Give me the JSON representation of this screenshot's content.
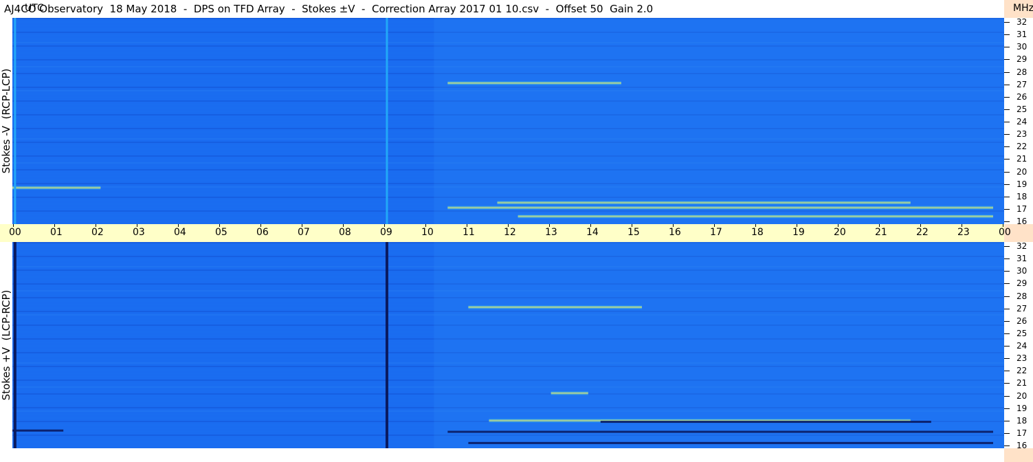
{
  "title": "AJ4CO Observatory  18 May 2018  -  DPS on TFD Array  -  Stokes ±V  -  Correction Array 2017 01 10.csv  -  Offset 50  Gain 2.0",
  "panels": {
    "top": {
      "label": "Stokes -V  (RCP-LCP)"
    },
    "bottom": {
      "label": "Stokes +V  (LCP-RCP)"
    }
  },
  "time_axis": {
    "utc_label": "UTC",
    "mhz_label": "MHz",
    "ticks": [
      "00",
      "01",
      "02",
      "03",
      "04",
      "05",
      "06",
      "07",
      "08",
      "09",
      "10",
      "11",
      "12",
      "13",
      "14",
      "15",
      "16",
      "17",
      "18",
      "19",
      "20",
      "21",
      "22",
      "23",
      "00"
    ]
  },
  "freq_axis": {
    "labels": [
      "32",
      "31",
      "30",
      "29",
      "28",
      "27",
      "26",
      "25",
      "24",
      "23",
      "22",
      "21",
      "20",
      "19",
      "18",
      "17",
      "16"
    ],
    "min_mhz": 16,
    "max_mhz": 32
  },
  "colors": {
    "base": "#1a6cf0",
    "deep": "#1048c8",
    "bright": "#22a8f8",
    "hot": "#f8f060",
    "dark": "#0a1a60",
    "timebar": "#ffffc8",
    "right_column": "#ffe2c8"
  },
  "chart_data": {
    "type": "heatmap",
    "x_range_utc_hours": [
      0,
      24
    ],
    "y_range_mhz": [
      16,
      32
    ],
    "top_vertical_lines_utc": [
      0.33,
      9.33
    ],
    "bottom_vertical_lines_utc": [
      0.33,
      9.33
    ],
    "top_bright_bands_mhz": [
      {
        "mhz": 27.1,
        "from_utc": 10.8,
        "to_utc": 15.0
      },
      {
        "mhz": 17.5,
        "from_utc": 12.0,
        "to_utc": 22.0
      },
      {
        "mhz": 17.1,
        "from_utc": 10.8,
        "to_utc": 24.0
      },
      {
        "mhz": 16.4,
        "from_utc": 12.5,
        "to_utc": 24.0
      },
      {
        "mhz": 18.7,
        "from_utc": 0.0,
        "to_utc": 2.4
      }
    ],
    "bottom_bright_bands_mhz": [
      {
        "mhz": 27.1,
        "from_utc": 11.3,
        "to_utc": 15.5
      },
      {
        "mhz": 18.0,
        "from_utc": 11.8,
        "to_utc": 22.0
      },
      {
        "mhz": 20.2,
        "from_utc": 13.3,
        "to_utc": 14.2
      }
    ],
    "bottom_dark_bands_mhz": [
      {
        "mhz": 17.1,
        "from_utc": 10.8,
        "to_utc": 24.0
      },
      {
        "mhz": 16.2,
        "from_utc": 11.3,
        "to_utc": 24.0
      },
      {
        "mhz": 17.9,
        "from_utc": 14.5,
        "to_utc": 22.5
      },
      {
        "mhz": 17.2,
        "from_utc": 0.0,
        "to_utc": 1.5
      }
    ]
  }
}
